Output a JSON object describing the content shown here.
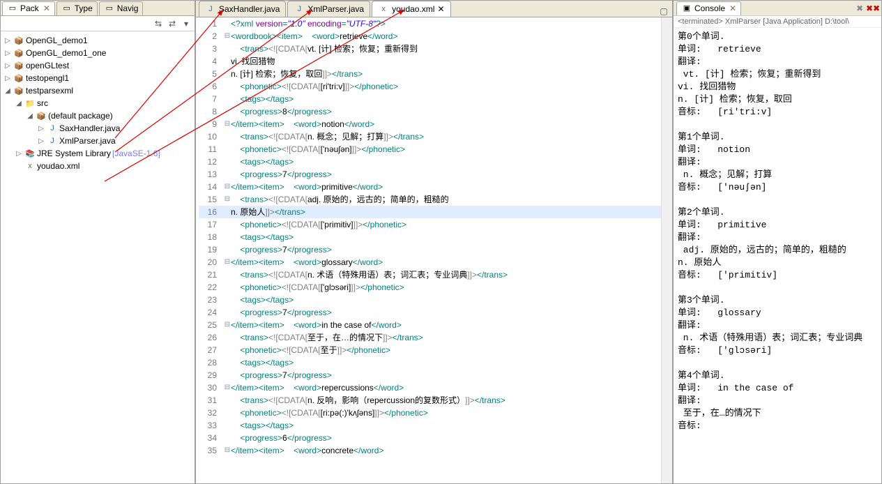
{
  "leftPane": {
    "tabs": [
      {
        "label": "Pack",
        "active": true
      },
      {
        "label": "Type",
        "active": false
      },
      {
        "label": "Navig",
        "active": false
      }
    ],
    "tree": [
      {
        "depth": 0,
        "tw": "▷",
        "icon": "📦",
        "cls": "proj",
        "label": "OpenGL_demo1"
      },
      {
        "depth": 0,
        "tw": "▷",
        "icon": "📦",
        "cls": "proj",
        "label": "OpenGL_demo1_one"
      },
      {
        "depth": 0,
        "tw": "▷",
        "icon": "📦",
        "cls": "proj",
        "label": "openGLtest"
      },
      {
        "depth": 0,
        "tw": "▷",
        "icon": "📦",
        "cls": "proj",
        "label": "testopengl1"
      },
      {
        "depth": 0,
        "tw": "◢",
        "icon": "📦",
        "cls": "proj",
        "label": "testparsexml"
      },
      {
        "depth": 1,
        "tw": "◢",
        "icon": "📁",
        "cls": "src",
        "label": "src"
      },
      {
        "depth": 2,
        "tw": "◢",
        "icon": "📦",
        "cls": "pkg",
        "label": "(default package)"
      },
      {
        "depth": 3,
        "tw": "▷",
        "icon": "J",
        "cls": "jfile",
        "label": "SaxHandler.java"
      },
      {
        "depth": 3,
        "tw": "▷",
        "icon": "J",
        "cls": "jfile",
        "label": "XmlParser.java"
      },
      {
        "depth": 1,
        "tw": "▷",
        "icon": "📚",
        "cls": "src",
        "label": "JRE System Library",
        "suffix": " [JavaSE-1.6]",
        "suffixCls": "highlight"
      },
      {
        "depth": 1,
        "tw": "",
        "icon": "x",
        "cls": "xfile",
        "label": "youdao.xml"
      }
    ]
  },
  "editor": {
    "tabs": [
      {
        "icon": "J",
        "cls": "jfile",
        "label": "SaxHandler.java",
        "active": false
      },
      {
        "icon": "J",
        "cls": "jfile",
        "label": "XmlParser.java",
        "active": false
      },
      {
        "icon": "x",
        "cls": "xfile",
        "label": "youdao.xml",
        "active": true,
        "close": true
      }
    ],
    "highlightLine": 16,
    "code": [
      {
        "n": 1,
        "fold": "",
        "seg": [
          [
            "pi",
            "<?xml "
          ],
          [
            "attr",
            "version"
          ],
          [
            "pi",
            "="
          ],
          [
            "str",
            "\"1.0\""
          ],
          [
            "pi",
            " "
          ],
          [
            "attr",
            "encoding"
          ],
          [
            "pi",
            "="
          ],
          [
            "str",
            "\"UTF-8\""
          ],
          [
            "pi",
            "?>"
          ]
        ]
      },
      {
        "n": 2,
        "fold": "⊟",
        "seg": [
          [
            "tag",
            "<wordbook><item>"
          ],
          [
            "txt",
            "    "
          ],
          [
            "tag",
            "<word>"
          ],
          [
            "txt",
            "retrieve"
          ],
          [
            "tag",
            "</word>"
          ]
        ]
      },
      {
        "n": 3,
        "fold": "",
        "seg": [
          [
            "txt",
            "    "
          ],
          [
            "tag",
            "<trans>"
          ],
          [
            "cdata",
            "<![CDATA["
          ],
          [
            "txt",
            "vt. [计] 检索；恢复；重新得到"
          ]
        ]
      },
      {
        "n": 4,
        "fold": "",
        "seg": [
          [
            "txt",
            "vi. 找回猎物"
          ]
        ]
      },
      {
        "n": 5,
        "fold": "",
        "seg": [
          [
            "txt",
            "n. [计] 检索；恢复，取回"
          ],
          [
            "cdata",
            "]]>"
          ],
          [
            "tag",
            "</trans>"
          ]
        ]
      },
      {
        "n": 6,
        "fold": "",
        "seg": [
          [
            "txt",
            "    "
          ],
          [
            "tag",
            "<phonetic>"
          ],
          [
            "cdata",
            "<![CDATA["
          ],
          [
            "txt",
            "[ri'tri:v]"
          ],
          [
            "cdata",
            "]]>"
          ],
          [
            "tag",
            "</phonetic>"
          ]
        ]
      },
      {
        "n": 7,
        "fold": "",
        "seg": [
          [
            "txt",
            "    "
          ],
          [
            "tag",
            "<tags></tags>"
          ]
        ]
      },
      {
        "n": 8,
        "fold": "",
        "seg": [
          [
            "txt",
            "    "
          ],
          [
            "tag",
            "<progress>"
          ],
          [
            "txt",
            "8"
          ],
          [
            "tag",
            "</progress>"
          ]
        ]
      },
      {
        "n": 9,
        "fold": "⊟",
        "seg": [
          [
            "tag",
            "</item><item>"
          ],
          [
            "txt",
            "    "
          ],
          [
            "tag",
            "<word>"
          ],
          [
            "txt",
            "notion"
          ],
          [
            "tag",
            "</word>"
          ]
        ]
      },
      {
        "n": 10,
        "fold": "",
        "seg": [
          [
            "txt",
            "    "
          ],
          [
            "tag",
            "<trans>"
          ],
          [
            "cdata",
            "<![CDATA["
          ],
          [
            "txt",
            "n. 概念；见解；打算"
          ],
          [
            "cdata",
            "]]>"
          ],
          [
            "tag",
            "</trans>"
          ]
        ]
      },
      {
        "n": 11,
        "fold": "",
        "seg": [
          [
            "txt",
            "    "
          ],
          [
            "tag",
            "<phonetic>"
          ],
          [
            "cdata",
            "<![CDATA["
          ],
          [
            "txt",
            "['nəuʃən]"
          ],
          [
            "cdata",
            "]]>"
          ],
          [
            "tag",
            "</phonetic>"
          ]
        ]
      },
      {
        "n": 12,
        "fold": "",
        "seg": [
          [
            "txt",
            "    "
          ],
          [
            "tag",
            "<tags></tags>"
          ]
        ]
      },
      {
        "n": 13,
        "fold": "",
        "seg": [
          [
            "txt",
            "    "
          ],
          [
            "tag",
            "<progress>"
          ],
          [
            "txt",
            "7"
          ],
          [
            "tag",
            "</progress>"
          ]
        ]
      },
      {
        "n": 14,
        "fold": "⊟",
        "seg": [
          [
            "tag",
            "</item><item>"
          ],
          [
            "txt",
            "    "
          ],
          [
            "tag",
            "<word>"
          ],
          [
            "txt",
            "primitive"
          ],
          [
            "tag",
            "</word>"
          ]
        ]
      },
      {
        "n": 15,
        "fold": "⊟",
        "seg": [
          [
            "txt",
            "    "
          ],
          [
            "tag",
            "<trans>"
          ],
          [
            "cdata",
            "<![CDATA["
          ],
          [
            "txt",
            "adj. 原始的，远古的；简单的，粗糙的"
          ]
        ]
      },
      {
        "n": 16,
        "fold": "",
        "seg": [
          [
            "txt",
            "n. 原始人"
          ],
          [
            "cdata",
            "]]>"
          ],
          [
            "tag",
            "</trans>"
          ]
        ]
      },
      {
        "n": 17,
        "fold": "",
        "seg": [
          [
            "txt",
            "    "
          ],
          [
            "tag",
            "<phonetic>"
          ],
          [
            "cdata",
            "<![CDATA["
          ],
          [
            "txt",
            "['primitiv]"
          ],
          [
            "cdata",
            "]]>"
          ],
          [
            "tag",
            "</phonetic>"
          ]
        ]
      },
      {
        "n": 18,
        "fold": "",
        "seg": [
          [
            "txt",
            "    "
          ],
          [
            "tag",
            "<tags></tags>"
          ]
        ]
      },
      {
        "n": 19,
        "fold": "",
        "seg": [
          [
            "txt",
            "    "
          ],
          [
            "tag",
            "<progress>"
          ],
          [
            "txt",
            "7"
          ],
          [
            "tag",
            "</progress>"
          ]
        ]
      },
      {
        "n": 20,
        "fold": "⊟",
        "seg": [
          [
            "tag",
            "</item><item>"
          ],
          [
            "txt",
            "    "
          ],
          [
            "tag",
            "<word>"
          ],
          [
            "txt",
            "glossary"
          ],
          [
            "tag",
            "</word>"
          ]
        ]
      },
      {
        "n": 21,
        "fold": "",
        "seg": [
          [
            "txt",
            "    "
          ],
          [
            "tag",
            "<trans>"
          ],
          [
            "cdata",
            "<![CDATA["
          ],
          [
            "txt",
            "n. 术语（特殊用语）表；词汇表；专业词典"
          ],
          [
            "cdata",
            "]]>"
          ],
          [
            "tag",
            "</trans>"
          ]
        ]
      },
      {
        "n": 22,
        "fold": "",
        "seg": [
          [
            "txt",
            "    "
          ],
          [
            "tag",
            "<phonetic>"
          ],
          [
            "cdata",
            "<![CDATA["
          ],
          [
            "txt",
            "['glɔsəri]"
          ],
          [
            "cdata",
            "]]>"
          ],
          [
            "tag",
            "</phonetic>"
          ]
        ]
      },
      {
        "n": 23,
        "fold": "",
        "seg": [
          [
            "txt",
            "    "
          ],
          [
            "tag",
            "<tags></tags>"
          ]
        ]
      },
      {
        "n": 24,
        "fold": "",
        "seg": [
          [
            "txt",
            "    "
          ],
          [
            "tag",
            "<progress>"
          ],
          [
            "txt",
            "7"
          ],
          [
            "tag",
            "</progress>"
          ]
        ]
      },
      {
        "n": 25,
        "fold": "⊟",
        "seg": [
          [
            "tag",
            "</item><item>"
          ],
          [
            "txt",
            "    "
          ],
          [
            "tag",
            "<word>"
          ],
          [
            "txt",
            "in the case of"
          ],
          [
            "tag",
            "</word>"
          ]
        ]
      },
      {
        "n": 26,
        "fold": "",
        "seg": [
          [
            "txt",
            "    "
          ],
          [
            "tag",
            "<trans>"
          ],
          [
            "cdata",
            "<![CDATA["
          ],
          [
            "txt",
            "至于，在…的情况下"
          ],
          [
            "cdata",
            "]]>"
          ],
          [
            "tag",
            "</trans>"
          ]
        ]
      },
      {
        "n": 27,
        "fold": "",
        "seg": [
          [
            "txt",
            "    "
          ],
          [
            "tag",
            "<phonetic>"
          ],
          [
            "cdata",
            "<![CDATA["
          ],
          [
            "txt",
            "至于"
          ],
          [
            "cdata",
            "]]>"
          ],
          [
            "tag",
            "</phonetic>"
          ]
        ]
      },
      {
        "n": 28,
        "fold": "",
        "seg": [
          [
            "txt",
            "    "
          ],
          [
            "tag",
            "<tags></tags>"
          ]
        ]
      },
      {
        "n": 29,
        "fold": "",
        "seg": [
          [
            "txt",
            "    "
          ],
          [
            "tag",
            "<progress>"
          ],
          [
            "txt",
            "7"
          ],
          [
            "tag",
            "</progress>"
          ]
        ]
      },
      {
        "n": 30,
        "fold": "⊟",
        "seg": [
          [
            "tag",
            "</item><item>"
          ],
          [
            "txt",
            "    "
          ],
          [
            "tag",
            "<word>"
          ],
          [
            "txt",
            "repercussions"
          ],
          [
            "tag",
            "</word>"
          ]
        ]
      },
      {
        "n": 31,
        "fold": "",
        "seg": [
          [
            "txt",
            "    "
          ],
          [
            "tag",
            "<trans>"
          ],
          [
            "cdata",
            "<![CDATA["
          ],
          [
            "txt",
            "n. 反响，影响（repercussion的复数形式）"
          ],
          [
            "cdata",
            "]]>"
          ],
          [
            "tag",
            "</trans>"
          ]
        ]
      },
      {
        "n": 32,
        "fold": "",
        "seg": [
          [
            "txt",
            "    "
          ],
          [
            "tag",
            "<phonetic>"
          ],
          [
            "cdata",
            "<![CDATA["
          ],
          [
            "txt",
            "[ri:pə(:)'kʌʃəns]"
          ],
          [
            "cdata",
            "]]>"
          ],
          [
            "tag",
            "</phonetic>"
          ]
        ]
      },
      {
        "n": 33,
        "fold": "",
        "seg": [
          [
            "txt",
            "    "
          ],
          [
            "tag",
            "<tags></tags>"
          ]
        ]
      },
      {
        "n": 34,
        "fold": "",
        "seg": [
          [
            "txt",
            "    "
          ],
          [
            "tag",
            "<progress>"
          ],
          [
            "txt",
            "6"
          ],
          [
            "tag",
            "</progress>"
          ]
        ]
      },
      {
        "n": 35,
        "fold": "⊟",
        "seg": [
          [
            "tag",
            "</item><item>"
          ],
          [
            "txt",
            "    "
          ],
          [
            "tag",
            "<word>"
          ],
          [
            "txt",
            "concrete"
          ],
          [
            "tag",
            "</word>"
          ]
        ]
      }
    ]
  },
  "console": {
    "title": "Console",
    "subtitle": "<terminated> XmlParser [Java Application] D:\\tool\\",
    "lines": [
      "第0个单词.",
      "单词:   retrieve",
      "翻译:",
      " vt. [计] 检索；恢复；重新得到",
      "vi. 找回猎物",
      "n. [计] 检索；恢复，取回",
      "音标:   [ri'tri:v]",
      "",
      "第1个单词.",
      "单词:   notion",
      "翻译:",
      " n. 概念；见解；打算",
      "音标:   ['nəuʃən]",
      "",
      "第2个单词.",
      "单词:   primitive",
      "翻译:",
      " adj. 原始的，远古的；简单的，粗糙的",
      "n. 原始人",
      "音标:   ['primitiv]",
      "",
      "第3个单词.",
      "单词:   glossary",
      "翻译:",
      " n. 术语（特殊用语）表；词汇表；专业词典",
      "音标:   ['glɔsəri]",
      "",
      "第4个单词.",
      "单词:   in the case of",
      "翻译:",
      " 至于，在…的情况下",
      "音标:"
    ]
  }
}
